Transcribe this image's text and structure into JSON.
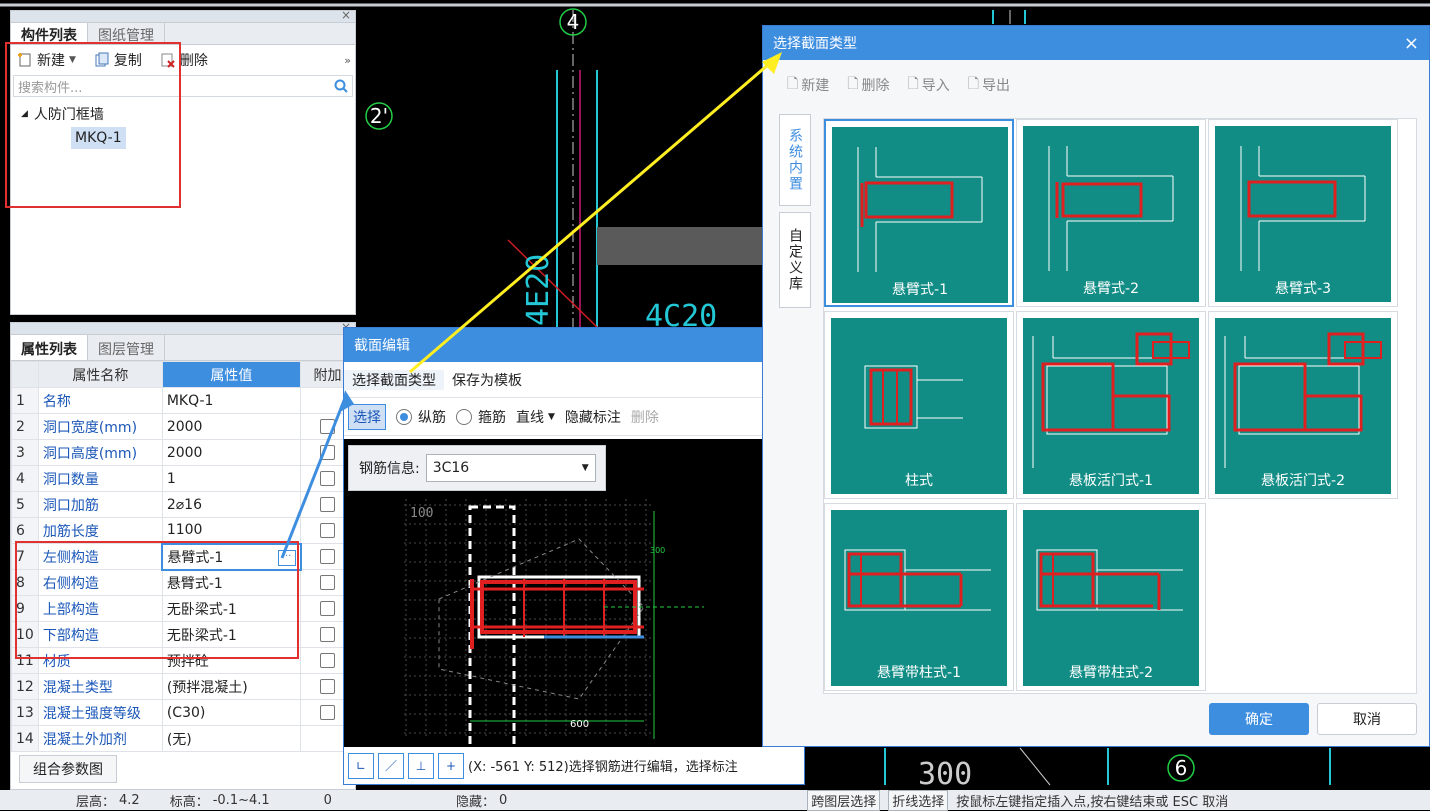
{
  "left_top": {
    "tabs": [
      "构件列表",
      "图纸管理"
    ],
    "toolbar": {
      "new": "新建",
      "copy": "复制",
      "delete": "删除"
    },
    "search_placeholder": "搜索构件...",
    "tree": {
      "group": "人防门框墙",
      "item": "MKQ-1"
    }
  },
  "left_bottom": {
    "tabs": [
      "属性列表",
      "图层管理"
    ],
    "headers": {
      "name": "属性名称",
      "value": "属性值",
      "extra": "附加"
    },
    "rows": [
      {
        "idx": "1",
        "name": "名称",
        "value": "MKQ-1",
        "check": false
      },
      {
        "idx": "2",
        "name": "洞口宽度(mm)",
        "value": "2000",
        "check": true
      },
      {
        "idx": "3",
        "name": "洞口高度(mm)",
        "value": "2000",
        "check": true
      },
      {
        "idx": "4",
        "name": "洞口数量",
        "value": "1",
        "check": true
      },
      {
        "idx": "5",
        "name": "洞口加筋",
        "value": "2⌀16",
        "check": true
      },
      {
        "idx": "6",
        "name": "加筋长度",
        "value": "1100",
        "check": true
      },
      {
        "idx": "7",
        "name": "左侧构造",
        "value": "悬臂式-1",
        "check": true
      },
      {
        "idx": "8",
        "name": "右侧构造",
        "value": "悬臂式-1",
        "check": true
      },
      {
        "idx": "9",
        "name": "上部构造",
        "value": "无卧梁式-1",
        "check": true
      },
      {
        "idx": "10",
        "name": "下部构造",
        "value": "无卧梁式-1",
        "check": true
      },
      {
        "idx": "11",
        "name": "材质",
        "value": "预拌砼",
        "check": true
      },
      {
        "idx": "12",
        "name": "混凝土类型",
        "value": "(预拌混凝土)",
        "check": true
      },
      {
        "idx": "13",
        "name": "混凝土强度等级",
        "value": "(C30)",
        "check": true
      },
      {
        "idx": "14",
        "name": "混凝土外加剂",
        "value": "(无)",
        "check": false
      }
    ],
    "combo_button": "组合参数图"
  },
  "cad": {
    "labels": {
      "axis4": "4",
      "axis2p": "2'",
      "axis6": "6",
      "rebar_v": "4E20",
      "rebar_h": "4C20",
      "dim": "300"
    }
  },
  "section_edit": {
    "title": "截面编辑",
    "menu": [
      "选择截面类型",
      "保存为模板"
    ],
    "tools": {
      "select": "选择",
      "long": "纵筋",
      "stirrup": "箍筋",
      "line": "直线",
      "hide": "隐藏标注",
      "delete": "删除"
    },
    "rebar_label": "钢筋信息:",
    "rebar_value": "3C16",
    "dims": {
      "left": "100",
      "bottom": "600",
      "right": "300"
    },
    "status": "(X: -561 Y: 512)选择钢筋进行编辑，选择标注"
  },
  "dialog": {
    "title": "选择截面类型",
    "toolbar": [
      "新建",
      "删除",
      "导入",
      "导出"
    ],
    "side_tabs": [
      "系统内置",
      "自定义库"
    ],
    "cards": [
      "悬臂式-1",
      "悬臂式-2",
      "悬臂式-3",
      "柱式",
      "悬板活门式-1",
      "悬板活门式-2",
      "悬臂带柱式-1",
      "悬臂带柱式-2"
    ],
    "ok": "确定",
    "cancel": "取消"
  },
  "statusbar": {
    "floor": "层高：",
    "floor_val": "4.2",
    "elev": "标高：",
    "elev_val": "-0.1~4.1",
    "zero": "0",
    "hidden": "隐藏：",
    "hidden_val": "0",
    "cross_layer": "跨图层选择",
    "polyline": "折线选择",
    "hint": "按鼠标左键指定插入点,按右键结束或 ESC 取消"
  },
  "colors": {
    "accent": "#3e8ee0",
    "teal": "#118d86",
    "rebar": "#e02020",
    "cad_green": "#22cc44",
    "cad_cyan": "#23c7d6",
    "highlight": "#e03030",
    "arrow_yellow": "#ffee22"
  }
}
